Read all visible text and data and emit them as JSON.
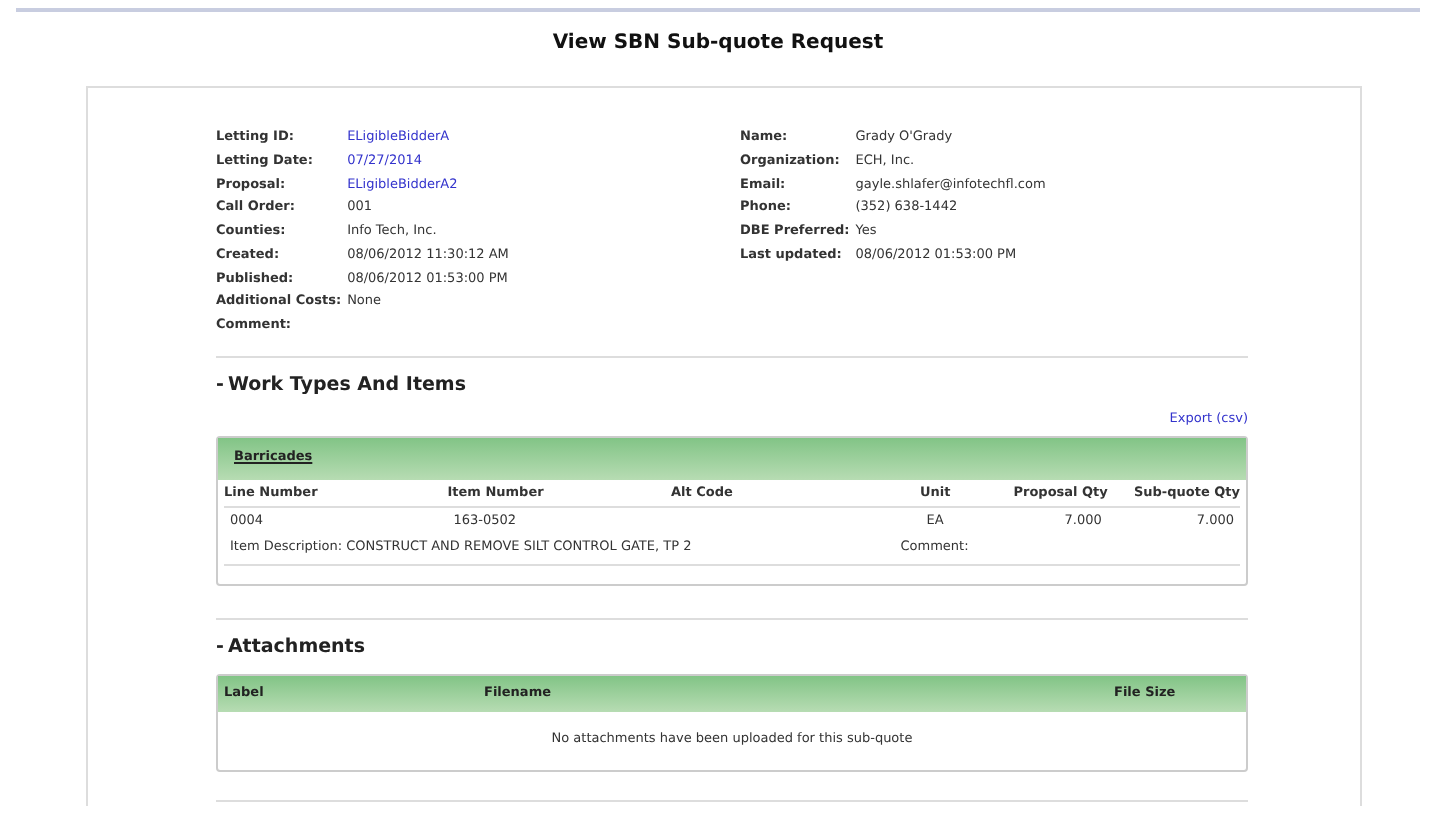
{
  "page_title": "View SBN Sub-quote Request",
  "details_left": [
    {
      "label": "Letting ID:",
      "value": "ELigibleBidderA",
      "link": true
    },
    {
      "label": "Letting Date:",
      "value": "07/27/2014",
      "link": true
    },
    {
      "label": "Proposal:",
      "value": "ELigibleBidderA2",
      "link": true
    },
    {
      "label": "Call Order:",
      "value": "001",
      "link": false
    },
    {
      "label": "Counties:",
      "value": "Info Tech, Inc.",
      "link": false
    },
    {
      "label": "Created:",
      "value": "08/06/2012 11:30:12 AM",
      "link": false
    },
    {
      "label": "Published:",
      "value": "08/06/2012 01:53:00 PM",
      "link": false
    },
    {
      "label": "Additional Costs:",
      "value": "None",
      "link": false
    },
    {
      "label": "Comment:"
    }
  ],
  "details_right": [
    {
      "label": "Name:",
      "value": "Grady O'Grady"
    },
    {
      "label": "Organization:",
      "value": "ECH, Inc."
    },
    {
      "label": "Email:",
      "value": "gayle.shlafer@infotechfl.com"
    },
    {
      "label": "Phone:",
      "value": "(352) 638-1442"
    },
    {
      "label": "DBE Preferred:",
      "value": "Yes"
    },
    {
      "label": "Last updated:",
      "value": "08/06/2012 01:53:00 PM"
    }
  ],
  "work_section": {
    "toggle": "-",
    "title": "Work Types And Items",
    "export_link": "Export (csv)",
    "group": {
      "title": "Barricades",
      "columns": [
        "Line Number",
        "Item Number",
        "Alt Code",
        "Unit",
        "Proposal Qty",
        "Sub-quote Qty"
      ],
      "rows": [
        {
          "cells": [
            "0004",
            "163-0502",
            "",
            "EA",
            "7.000",
            "7.000"
          ],
          "description": "Item Description: CONSTRUCT AND REMOVE SILT CONTROL GATE, TP 2",
          "comment_label": "Comment:"
        }
      ]
    }
  },
  "attachments_section": {
    "toggle": "-",
    "title": "Attachments",
    "columns": [
      "Label",
      "Filename",
      "File Size"
    ],
    "empty_message": "No attachments have been uploaded for this sub-quote"
  }
}
